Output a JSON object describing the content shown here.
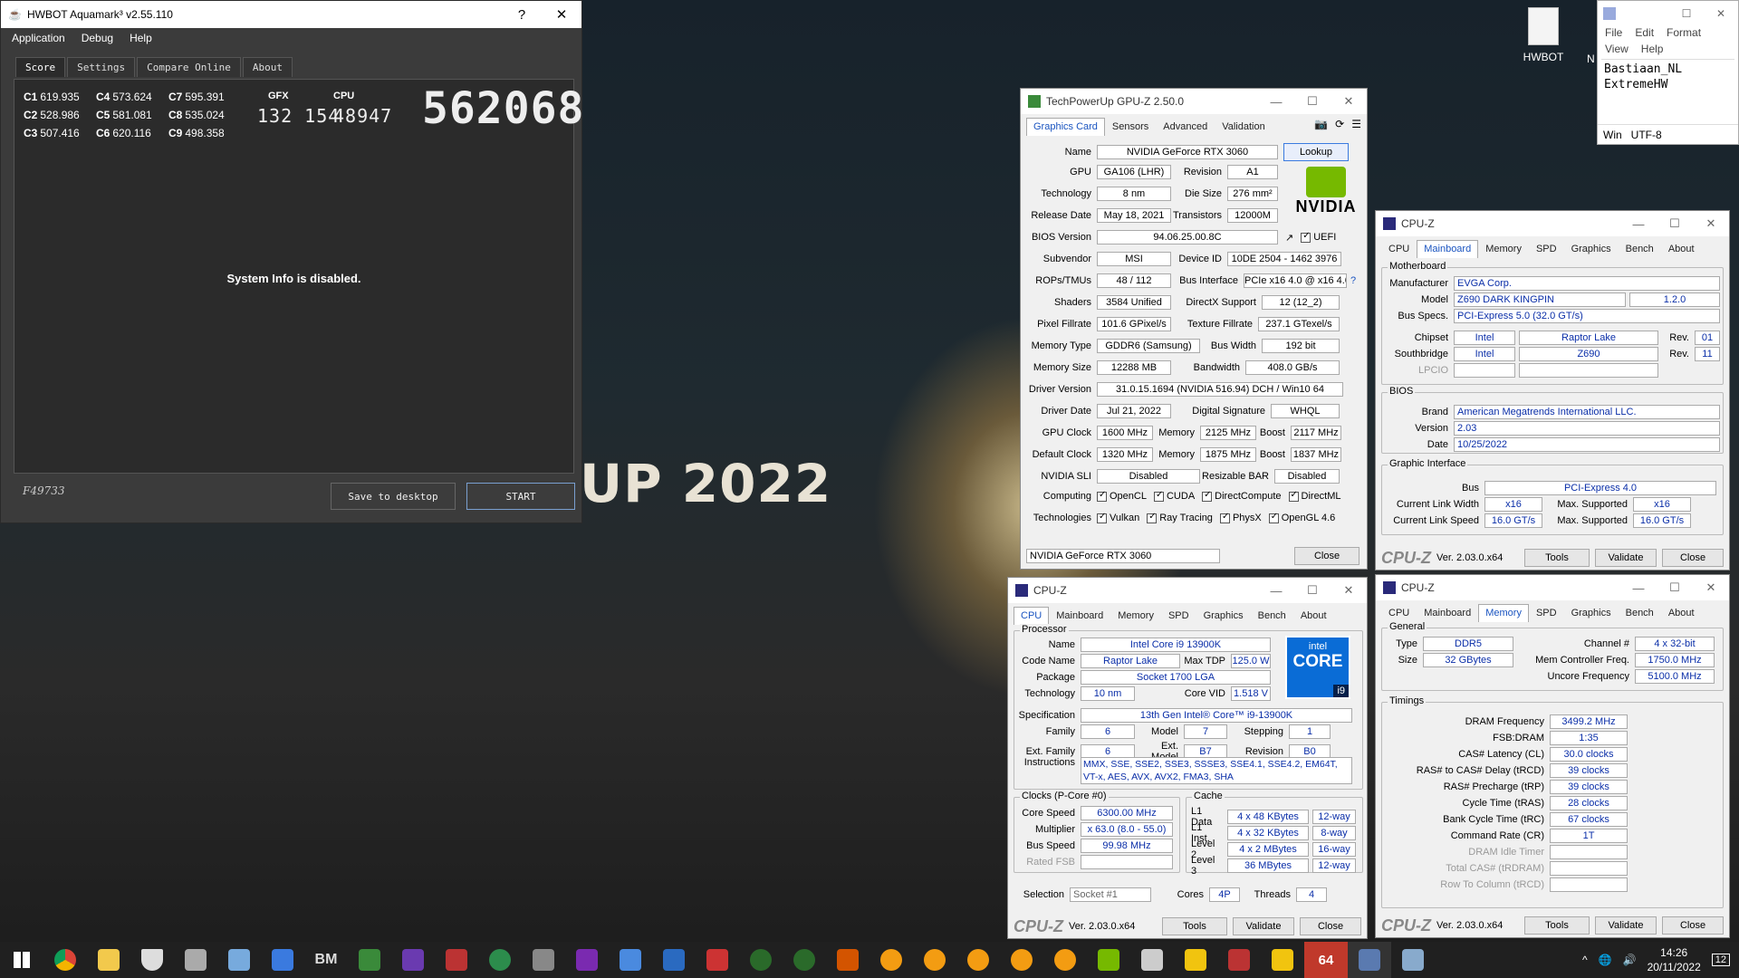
{
  "desktop": {
    "year": "UP 2022",
    "icon_label": "HWBOT",
    "icon2_label": "N"
  },
  "aquamark": {
    "title": "HWBOT Aquamark³ v2.55.110",
    "help": "?",
    "close": "✕",
    "menu": [
      "Application",
      "Debug",
      "Help"
    ],
    "tabs": [
      "Score",
      "Settings",
      "Compare Online",
      "About"
    ],
    "scores": [
      {
        "k": "C1",
        "v": "619.935"
      },
      {
        "k": "C2",
        "v": "528.986"
      },
      {
        "k": "C3",
        "v": "507.416"
      },
      {
        "k": "C4",
        "v": "573.624"
      },
      {
        "k": "C5",
        "v": "581.081"
      },
      {
        "k": "C6",
        "v": "620.116"
      },
      {
        "k": "C7",
        "v": "595.391"
      },
      {
        "k": "C8",
        "v": "535.024"
      },
      {
        "k": "C9",
        "v": "498.358"
      }
    ],
    "gfx_label": "GFX",
    "gfx": "132 154",
    "cpu_label": "CPU",
    "cpu": "48947",
    "total": "562068",
    "sysinfo": "System Info is disabled.",
    "code": "F49733",
    "save": "Save to desktop",
    "start": "START"
  },
  "gpuz": {
    "title": "TechPowerUp GPU-Z 2.50.0",
    "tabs": [
      "Graphics Card",
      "Sensors",
      "Advanced",
      "Validation"
    ],
    "lookup": "Lookup",
    "name_l": "Name",
    "name": "NVIDIA GeForce RTX 3060",
    "gpu_l": "GPU",
    "gpu": "GA106 (LHR)",
    "rev_l": "Revision",
    "rev": "A1",
    "tech_l": "Technology",
    "tech": "8 nm",
    "die_l": "Die Size",
    "die": "276 mm²",
    "rel_l": "Release Date",
    "rel": "May 18, 2021",
    "tr_l": "Transistors",
    "tr": "12000M",
    "bios_l": "BIOS Version",
    "bios": "94.06.25.00.8C",
    "uefi": "UEFI",
    "sub_l": "Subvendor",
    "sub": "MSI",
    "dev_l": "Device ID",
    "dev": "10DE 2504 - 1462 3976",
    "rops_l": "ROPs/TMUs",
    "rops": "48 / 112",
    "bus_l": "Bus Interface",
    "bus": "PCIe x16 4.0 @ x16 4.0",
    "q": "?",
    "sh_l": "Shaders",
    "sh": "3584 Unified",
    "dx_l": "DirectX Support",
    "dx": "12 (12_2)",
    "pf_l": "Pixel Fillrate",
    "pf": "101.6 GPixel/s",
    "tf_l": "Texture Fillrate",
    "tf": "237.1 GTexel/s",
    "mt_l": "Memory Type",
    "mt": "GDDR6 (Samsung)",
    "bw_l": "Bus Width",
    "bw": "192 bit",
    "ms_l": "Memory Size",
    "ms": "12288 MB",
    "band_l": "Bandwidth",
    "band": "408.0 GB/s",
    "dv_l": "Driver Version",
    "dv": "31.0.15.1694 (NVIDIA 516.94) DCH / Win10 64",
    "dd_l": "Driver Date",
    "dd": "Jul 21, 2022",
    "ds_l": "Digital Signature",
    "ds": "WHQL",
    "gc_l": "GPU Clock",
    "gc": "1600 MHz",
    "mem_l": "Memory",
    "gmem": "2125 MHz",
    "boost_l": "Boost",
    "gb": "2117 MHz",
    "dc_l": "Default Clock",
    "dc": "1320 MHz",
    "dmem": "1875 MHz",
    "db": "1837 MHz",
    "sli_l": "NVIDIA SLI",
    "sli": "Disabled",
    "rb_l": "Resizable BAR",
    "rb": "Disabled",
    "comp_l": "Computing",
    "comp": [
      "OpenCL",
      "CUDA",
      "DirectCompute",
      "DirectML"
    ],
    "techs_l": "Technologies",
    "techs": [
      "Vulkan",
      "Ray Tracing",
      "PhysX",
      "OpenGL 4.6"
    ],
    "select": "NVIDIA GeForce RTX 3060",
    "close": "Close",
    "brand": "NVIDIA"
  },
  "cpuz_mb": {
    "title": "CPU-Z",
    "tabs": [
      "CPU",
      "Mainboard",
      "Memory",
      "SPD",
      "Graphics",
      "Bench",
      "About"
    ],
    "g_mb": "Motherboard",
    "man_l": "Manufacturer",
    "man": "EVGA Corp.",
    "mod_l": "Model",
    "mod": "Z690 DARK KINGPIN",
    "modrev": "1.2.0",
    "bs_l": "Bus Specs.",
    "bs": "PCI-Express 5.0 (32.0 GT/s)",
    "cs_l": "Chipset",
    "cs1": "Intel",
    "cs2": "Raptor Lake",
    "rev_l": "Rev.",
    "csr": "01",
    "sb_l": "Southbridge",
    "sb1": "Intel",
    "sb2": "Z690",
    "sbr": "11",
    "lpc_l": "LPCIO",
    "g_bios": "BIOS",
    "br_l": "Brand",
    "br": "American Megatrends International LLC.",
    "ver_l": "Version",
    "ver": "2.03",
    "date_l": "Date",
    "date": "10/25/2022",
    "g_gi": "Graphic Interface",
    "gbus_l": "Bus",
    "gbus": "PCI-Express 4.0",
    "clw_l": "Current Link Width",
    "clw": "x16",
    "msup_l": "Max. Supported",
    "mlw": "x16",
    "cls_l": "Current Link Speed",
    "cls": "16.0 GT/s",
    "mls": "16.0 GT/s",
    "logo": "CPU-Z",
    "version": "Ver. 2.03.0.x64",
    "tools": "Tools",
    "validate": "Validate",
    "close": "Close"
  },
  "cpuz_cpu": {
    "title": "CPU-Z",
    "tabs": [
      "CPU",
      "Mainboard",
      "Memory",
      "SPD",
      "Graphics",
      "Bench",
      "About"
    ],
    "g_proc": "Processor",
    "name_l": "Name",
    "name": "Intel Core i9 13900K",
    "cn_l": "Code Name",
    "cn": "Raptor Lake",
    "tdp_l": "Max TDP",
    "tdp": "125.0 W",
    "pk_l": "Package",
    "pk": "Socket 1700 LGA",
    "tech_l": "Technology",
    "tech": "10 nm",
    "vid_l": "Core VID",
    "vid": "1.518 V",
    "spec_l": "Specification",
    "spec": "13th Gen Intel® Core™ i9-13900K",
    "fam_l": "Family",
    "fam": "6",
    "model_l": "Model",
    "model": "7",
    "step_l": "Stepping",
    "step": "1",
    "ef_l": "Ext. Family",
    "ef": "6",
    "em_l": "Ext. Model",
    "em": "B7",
    "rev_l": "Revision",
    "rev": "B0",
    "ins_l": "Instructions",
    "ins": "MMX, SSE, SSE2, SSE3, SSSE3, SSE4.1, SSE4.2, EM64T, VT-x, AES, AVX, AVX2, FMA3, SHA",
    "g_clk": "Clocks (P-Core #0)",
    "cs_l": "Core Speed",
    "cs": "6300.00 MHz",
    "mul_l": "Multiplier",
    "mul": "x 63.0 (8.0 - 55.0)",
    "bsp_l": "Bus Speed",
    "bsp": "99.98 MHz",
    "rf_l": "Rated FSB",
    "g_cache": "Cache",
    "l1d_l": "L1 Data",
    "l1d": "4 x 48 KBytes",
    "l1dw": "12-way",
    "l1i_l": "L1 Inst.",
    "l1i": "4 x 32 KBytes",
    "l1iw": "8-way",
    "l2_l": "Level 2",
    "l2": "4 x 2 MBytes",
    "l2w": "16-way",
    "l3_l": "Level 3",
    "l3": "36 MBytes",
    "l3w": "12-way",
    "sel_l": "Selection",
    "sel": "Socket #1",
    "cores_l": "Cores",
    "cores": "4P",
    "thr_l": "Threads",
    "thr": "4",
    "badge_brand": "intel",
    "badge_core": "CORE",
    "badge_i": "i9",
    "logo": "CPU-Z",
    "version": "Ver. 2.03.0.x64",
    "tools": "Tools",
    "validate": "Validate",
    "close": "Close"
  },
  "cpuz_mem": {
    "title": "CPU-Z",
    "tabs": [
      "CPU",
      "Mainboard",
      "Memory",
      "SPD",
      "Graphics",
      "Bench",
      "About"
    ],
    "g_gen": "General",
    "type_l": "Type",
    "type": "DDR5",
    "ch_l": "Channel #",
    "ch": "4 x 32-bit",
    "size_l": "Size",
    "size": "32 GBytes",
    "mcf_l": "Mem Controller Freq.",
    "mcf": "1750.0 MHz",
    "unc_l": "Uncore Frequency",
    "unc": "5100.0 MHz",
    "g_tim": "Timings",
    "timings": [
      {
        "l": "DRAM Frequency",
        "v": "3499.2 MHz"
      },
      {
        "l": "FSB:DRAM",
        "v": "1:35"
      },
      {
        "l": "CAS# Latency (CL)",
        "v": "30.0 clocks"
      },
      {
        "l": "RAS# to CAS# Delay (tRCD)",
        "v": "39 clocks"
      },
      {
        "l": "RAS# Precharge (tRP)",
        "v": "39 clocks"
      },
      {
        "l": "Cycle Time (tRAS)",
        "v": "28 clocks"
      },
      {
        "l": "Bank Cycle Time (tRC)",
        "v": "67 clocks"
      },
      {
        "l": "Command Rate (CR)",
        "v": "1T"
      },
      {
        "l": "DRAM Idle Timer",
        "v": ""
      },
      {
        "l": "Total CAS# (tRDRAM)",
        "v": ""
      },
      {
        "l": "Row To Column (tRCD)",
        "v": ""
      }
    ],
    "logo": "CPU-Z",
    "version": "Ver. 2.03.0.x64",
    "tools": "Tools",
    "validate": "Validate",
    "close": "Close"
  },
  "notepad": {
    "menu": [
      "File",
      "Edit",
      "Format",
      "View",
      "Help"
    ],
    "line1": "Bastiaan_NL",
    "line2": "ExtremeHW",
    "status1": "Win",
    "status2": "UTF-8"
  },
  "taskbar": {
    "time": "14:26",
    "date": "20/11/2022",
    "notif": "12",
    "icons": [
      "start-icon",
      "search-icon",
      "chrome-icon",
      "explorer-icon",
      "security-icon",
      "app-icon",
      "app-icon",
      "app-icon",
      "bm-icon",
      "gpuz-icon",
      "cpuz-icon",
      "app-icon",
      "app-icon",
      "app-icon",
      "app-icon",
      "app-icon",
      "app-icon",
      "app-icon",
      "app-icon",
      "pi-icon",
      "pi-icon",
      "app-icon",
      "app-icon",
      "app-icon",
      "app-icon",
      "app-icon",
      "app-icon",
      "nvidia-icon",
      "app-icon",
      "app-icon",
      "app-icon",
      "app-icon",
      "aida-icon",
      "app-icon",
      "app-icon"
    ],
    "bm": "BM",
    "n64": "64"
  }
}
